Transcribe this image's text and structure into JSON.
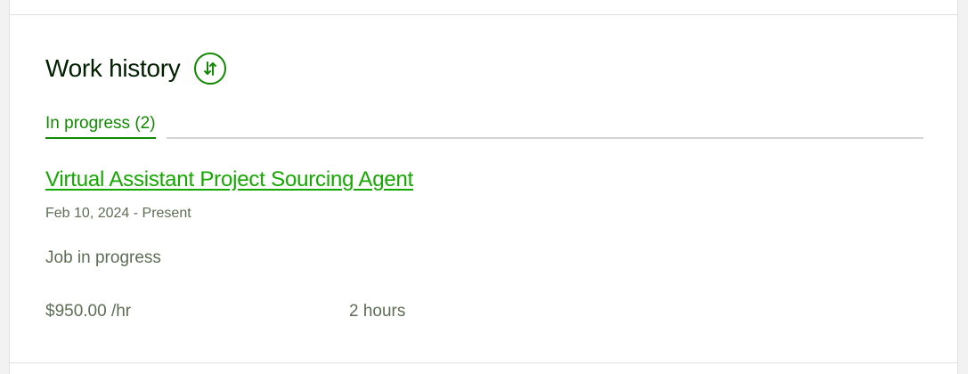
{
  "section": {
    "title": "Work history"
  },
  "tabs": [
    {
      "label": "In progress (2)",
      "active": true
    }
  ],
  "jobs": [
    {
      "title": "Virtual Assistant Project Sourcing Agent",
      "dates": "Feb 10, 2024 - Present",
      "status": "Job in progress",
      "rate": "$950.00 /hr",
      "hours": "2 hours"
    }
  ],
  "icons": {
    "sort": "sort-arrows-icon"
  },
  "colors": {
    "accent": "#108a00",
    "link": "#14a800",
    "muted_text": "#5e6d55",
    "heading": "#001e00"
  }
}
